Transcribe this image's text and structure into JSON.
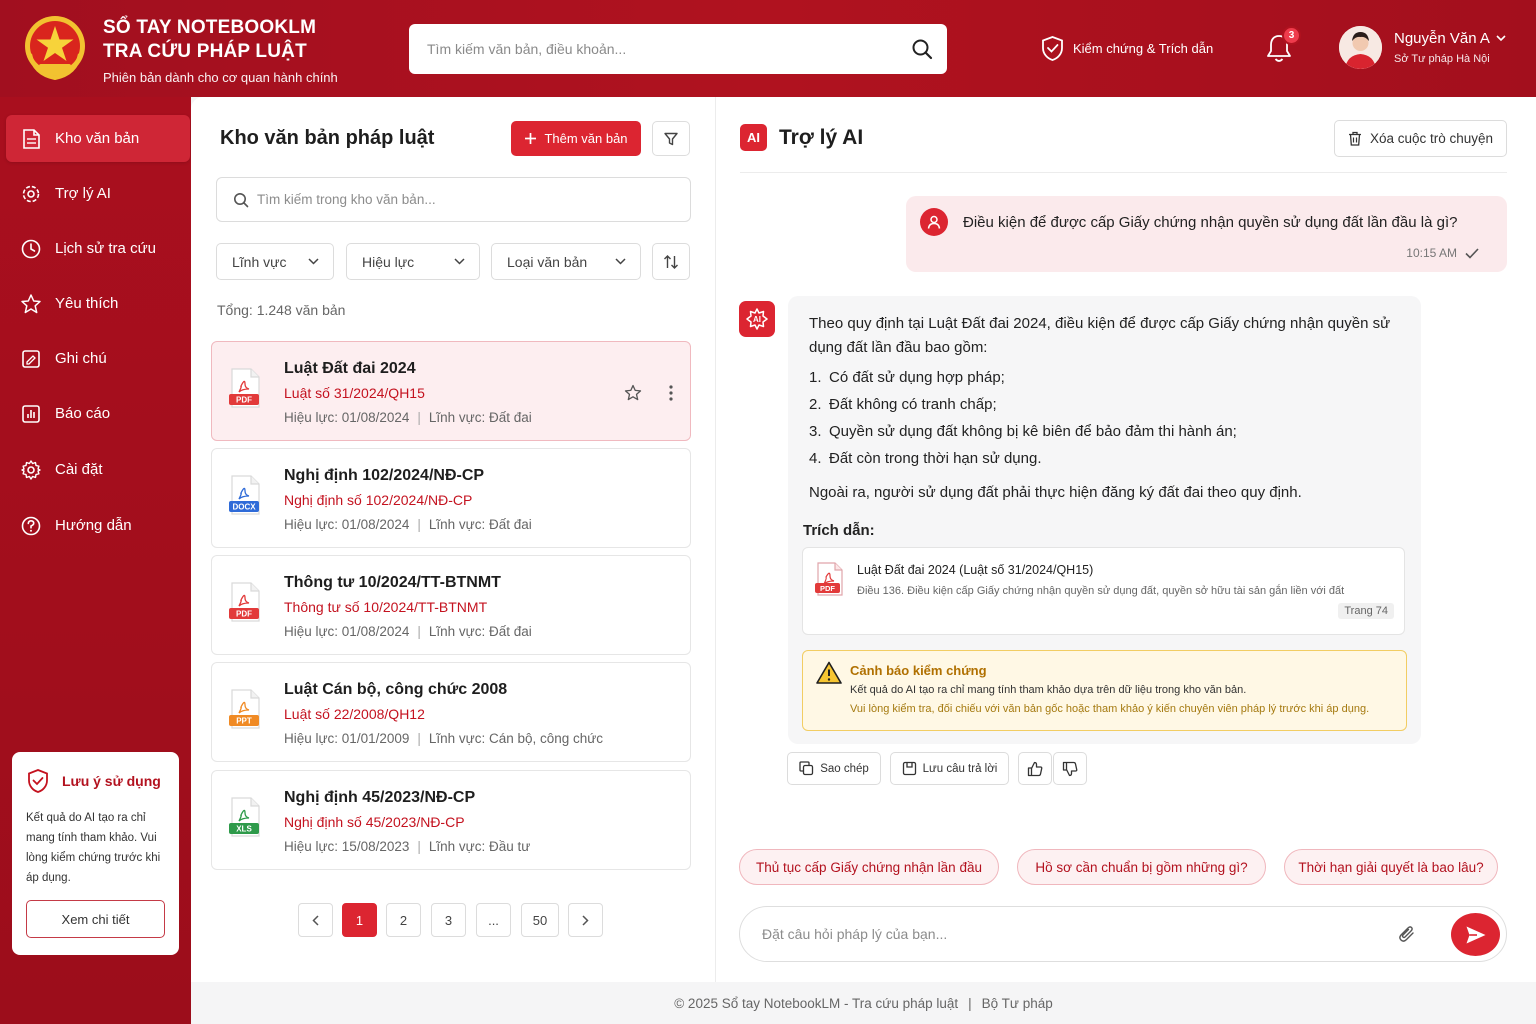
{
  "header": {
    "brand_line1": "SỔ TAY NOTEBOOKLM",
    "brand_line2": "TRA CỨU PHÁP LUẬT",
    "brand_sub": "Phiên bản dành cho cơ quan hành chính",
    "search_placeholder": "Tìm kiếm văn bản, điều khoản...",
    "verify_label": "Kiểm chứng & Trích dẫn",
    "notification_count": "3",
    "user_name": "Nguyễn Văn A",
    "user_org": "Sở Tư pháp Hà Nội"
  },
  "sidebar": {
    "items": [
      {
        "label": "Kho văn bản",
        "icon": "document-icon",
        "active": true
      },
      {
        "label": "Trợ lý AI",
        "icon": "ai-gear-icon"
      },
      {
        "label": "Lịch sử tra cứu",
        "icon": "clock-icon"
      },
      {
        "label": "Yêu thích",
        "icon": "star-icon"
      },
      {
        "label": "Ghi chú",
        "icon": "note-icon"
      },
      {
        "label": "Báo cáo",
        "icon": "report-icon"
      },
      {
        "label": "Cài đặt",
        "icon": "gear-icon"
      },
      {
        "label": "Hướng dẫn",
        "icon": "help-icon"
      }
    ],
    "notice": {
      "title": "Lưu ý sử dụng",
      "text": "Kết quả do AI tạo ra chỉ mang tính tham khảo. Vui lòng kiểm chứng trước khi áp dụng.",
      "button": "Xem chi tiết"
    }
  },
  "library": {
    "title": "Kho văn bản pháp luật",
    "add_button": "Thêm văn bản",
    "search_placeholder": "Tìm kiếm trong kho văn bản...",
    "filters": [
      "Lĩnh vực",
      "Hiệu lực",
      "Loại văn bản"
    ],
    "total": "Tổng: 1.248 văn bản",
    "documents": [
      {
        "title": "Luật Đất đai 2024",
        "number": "Luật số 31/2024/QH15",
        "effective": "Hiệu lực: 01/08/2024",
        "field": "Lĩnh vực: Đất đai",
        "type": "PDF",
        "color": "#e23a3a"
      },
      {
        "title": "Nghị định 102/2024/NĐ-CP",
        "number": "Nghị định số 102/2024/NĐ-CP",
        "effective": "Hiệu lực: 01/08/2024",
        "field": "Lĩnh vực: Đất đai",
        "type": "DOCX",
        "color": "#2f6bd8"
      },
      {
        "title": "Thông tư 10/2024/TT-BTNMT",
        "number": "Thông tư số 10/2024/TT-BTNMT",
        "effective": "Hiệu lực: 01/08/2024",
        "field": "Lĩnh vực: Đất đai",
        "type": "PDF",
        "color": "#e23a3a"
      },
      {
        "title": "Luật Cán bộ, công chức 2008",
        "number": "Luật số 22/2008/QH12",
        "effective": "Hiệu lực: 01/01/2009",
        "field": "Lĩnh vực: Cán bộ, công chức",
        "type": "PPT",
        "color": "#f08a24"
      },
      {
        "title": "Nghị định 45/2023/NĐ-CP",
        "number": "Nghị định số 45/2023/NĐ-CP",
        "effective": "Hiệu lực: 15/08/2023",
        "field": "Lĩnh vực: Đầu tư",
        "type": "XLS",
        "color": "#2e9a4a"
      }
    ],
    "pagination": [
      "1",
      "2",
      "3",
      "...",
      "50"
    ]
  },
  "assistant": {
    "logo": "AI",
    "title": "Trợ lý AI",
    "clear_button": "Xóa cuộc trò chuyện",
    "user_question": "Điều kiện để được cấp Giấy chứng nhận quyền sử dụng đất lần đầu là gì?",
    "user_time": "10:15 AM",
    "answer_intro": "Theo quy định tại Luật Đất đai 2024, điều kiện để được cấp Giấy chứng nhận quyền sử dụng đất lần đầu bao gồm:",
    "answer_items": [
      {
        "n": "1.",
        "text": "Có đất sử dụng hợp pháp;"
      },
      {
        "n": "2.",
        "text": "Đất không có tranh chấp;"
      },
      {
        "n": "3.",
        "text": "Quyền sử dụng đất không bị kê biên để bảo đảm thi hành án;"
      },
      {
        "n": "4.",
        "text": "Đất còn trong thời hạn sử dụng."
      }
    ],
    "answer_note": "Ngoài ra, người sử dụng đất phải thực hiện đăng ký đất đai theo quy định.",
    "citation_label": "Trích dẫn:",
    "citation": {
      "type": "PDF",
      "title": "Luật Đất đai 2024 (Luật số 31/2024/QH15)",
      "desc": "Điều 136. Điều kiện cấp Giấy chứng nhận quyền sử dụng đất, quyền sở hữu tài sản gắn liền với đất",
      "page": "Trang 74"
    },
    "warning": {
      "title": "Cảnh báo kiểm chứng",
      "line1": "Kết quả do AI tạo ra chỉ mang tính tham khảo dựa trên dữ liệu trong kho văn bản.",
      "line2": "Vui lòng kiểm tra, đối chiếu với văn bản gốc hoặc tham khảo ý kiến chuyên viên pháp lý trước khi áp dụng."
    },
    "actions": {
      "copy": "Sao chép",
      "save": "Lưu câu trả lời"
    },
    "suggestions": [
      "Thủ tục cấp Giấy chứng nhận lần đầu",
      "Hồ sơ cần chuẩn bị gồm những gì?",
      "Thời hạn giải quyết là bao lâu?"
    ],
    "composer_placeholder": "Đặt câu hỏi pháp lý của bạn..."
  },
  "footer": {
    "text": "© 2025 Sổ tay NotebookLM - Tra cứu pháp luật",
    "org": "Bộ Tư pháp"
  },
  "colors": {
    "brand_red": "#b0121f",
    "accent_red": "#dc2531",
    "warning": "#b07000"
  }
}
